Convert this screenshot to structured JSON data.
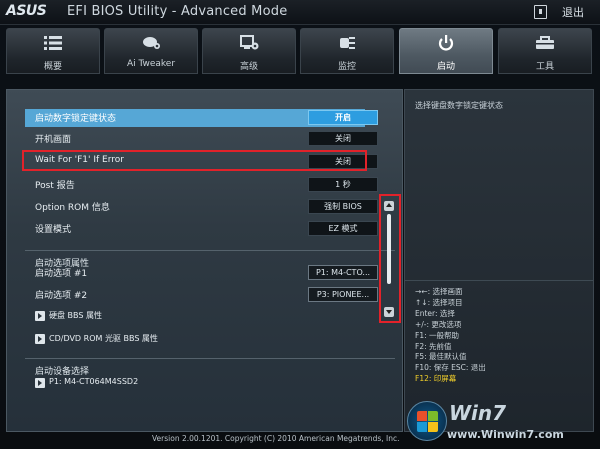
{
  "window": {
    "brand": "ASUS",
    "title": "EFI BIOS Utility - Advanced Mode",
    "exit_label": "退出"
  },
  "tabs": [
    {
      "label": "概要",
      "icon": "list-icon"
    },
    {
      "label": "Ai Tweaker",
      "icon": "tweaker-icon"
    },
    {
      "label": "高级",
      "icon": "advanced-icon"
    },
    {
      "label": "监控",
      "icon": "monitor-icon"
    },
    {
      "label": "启动",
      "icon": "power-icon",
      "active": true
    },
    {
      "label": "工具",
      "icon": "tool-icon"
    }
  ],
  "settings": [
    {
      "label": "启动数字锁定键状态",
      "value": "开启",
      "selected": true
    },
    {
      "label": "开机画面",
      "value": "关闭"
    },
    {
      "label": "Wait For 'F1' If Error",
      "value": "关闭"
    },
    {
      "label": "Post 报告",
      "value": "1 秒"
    },
    {
      "label": "Option ROM 信息",
      "value": "强制 BIOS"
    },
    {
      "label": "设置模式",
      "value": "EZ 模式"
    }
  ],
  "boot_options": {
    "section_title": "启动选项属性",
    "items": [
      {
        "label": "启动选项 #1",
        "value": "P1: M4-CTO..."
      },
      {
        "label": "启动选项 #2",
        "value": "P3: PIONEE..."
      }
    ],
    "submenus": [
      {
        "label": "硬盘 BBS 属性"
      },
      {
        "label": "CD/DVD ROM 光驱 BBS 属性"
      }
    ]
  },
  "boot_override": {
    "section_title": "启动设备选择",
    "items": [
      {
        "label": "P1: M4-CT064M4SSD2"
      }
    ]
  },
  "help": {
    "description": "选择键盘数字锁定键状态",
    "keys": [
      "→←: 选择画面",
      "↑↓: 选择项目",
      "Enter: 选择",
      "+/-: 更改选项",
      "F1: 一般帮助",
      "F2: 先前值",
      "F5: 最佳默认值",
      "F10: 保存  ESC: 退出",
      "F12: 印屏幕"
    ],
    "highlight_color": "#f1cf2a"
  },
  "footer": {
    "version": "Version 2.00.1201. Copyright (C) 2010 American Megatrends, Inc."
  },
  "watermark": {
    "brand": "Win7",
    "url": "www.Winwin7.com"
  },
  "colors": {
    "highlight_row": "#56a7d6",
    "annotation_red": "#e2222a"
  }
}
